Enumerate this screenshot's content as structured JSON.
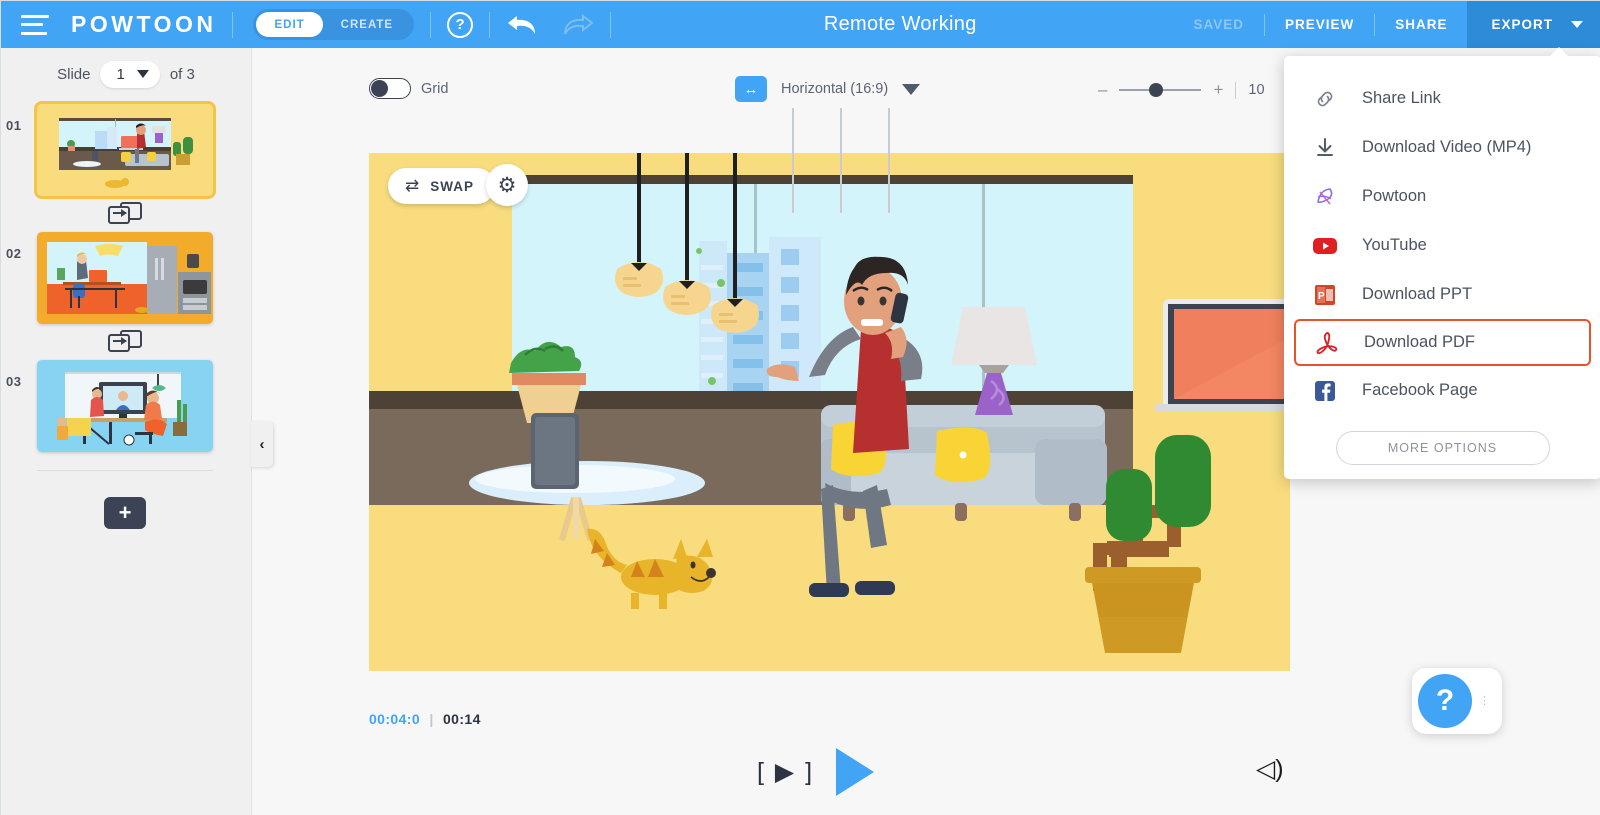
{
  "topbar": {
    "brand": "POWTOON",
    "mode_edit": "EDIT",
    "mode_create": "CREATE",
    "help_glyph": "?",
    "doc_title": "Remote Working",
    "saved_label": "SAVED",
    "preview_label": "PREVIEW",
    "share_label": "SHARE",
    "export_label": "EXPORT",
    "accent_color": "#41a4f5",
    "export_bg_color": "#2e8bd8"
  },
  "sidebar": {
    "slide_word": "Slide",
    "current_slide": "1",
    "of_text": "of 3",
    "collapse_glyph": "‹",
    "add_slide_glyph": "+",
    "slides": [
      {
        "num": "01",
        "selected": true
      },
      {
        "num": "02",
        "selected": false
      },
      {
        "num": "03",
        "selected": false
      }
    ]
  },
  "canvas_toolbar": {
    "grid_label": "Grid",
    "grid_on": false,
    "aspect_label": "Horizontal (16:9)",
    "aspect_glyph": "↔",
    "zoom_minus": "–",
    "zoom_plus": "+",
    "zoom_percent": "10"
  },
  "stage": {
    "swap_label": "SWAP",
    "swap_glyph": "⇄",
    "gear_glyph": "⚙",
    "background_color": "#f8dc7e"
  },
  "player": {
    "current_time": "00:04:0",
    "separator": "|",
    "total_time": "00:14",
    "preview_slide_glyph": "[ ▶ ]",
    "sound_glyph": "◁)"
  },
  "help_fab": {
    "glyph": "?",
    "dots": "⋮"
  },
  "export_menu": {
    "items": [
      {
        "label": "Share Link",
        "icon": "link-icon",
        "highlighted": false
      },
      {
        "label": "Download Video (MP4)",
        "icon": "download-icon",
        "highlighted": false
      },
      {
        "label": "Powtoon",
        "icon": "powtoon-icon",
        "highlighted": false
      },
      {
        "label": "YouTube",
        "icon": "youtube-icon",
        "highlighted": false
      },
      {
        "label": "Download PPT",
        "icon": "powerpoint-icon",
        "highlighted": false
      },
      {
        "label": "Download PDF",
        "icon": "pdf-icon",
        "highlighted": true
      },
      {
        "label": "Facebook Page",
        "icon": "facebook-icon",
        "highlighted": false
      }
    ],
    "more_options_label": "MORE OPTIONS",
    "highlight_color": "#e8542a"
  }
}
